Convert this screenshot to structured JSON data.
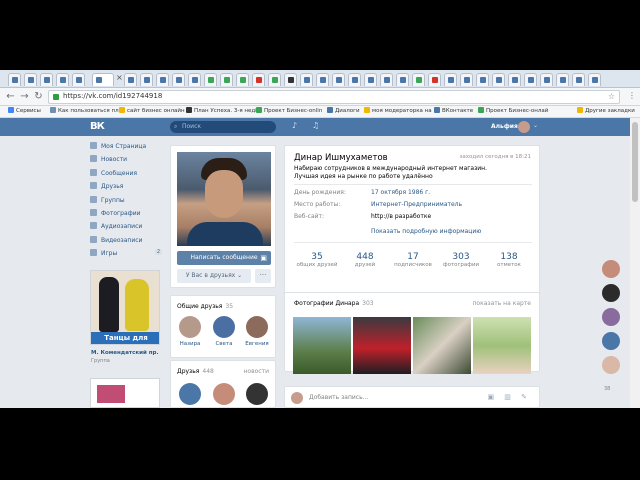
{
  "browser": {
    "tab_close": "×",
    "url": "https://vk.com/id192744918",
    "star": "☆",
    "menu": "⋮"
  },
  "bookmarks": [
    {
      "label": "Сервисы",
      "color": "#4285f4"
    },
    {
      "label": "Как пользоваться пл",
      "color": "#6f8fb5"
    },
    {
      "label": "сайт бизнес онлайн",
      "color": "#f2b705"
    },
    {
      "label": "План Успеха. 3-я неді",
      "color": "#333333"
    },
    {
      "label": "Проект Бизнес-onlin",
      "color": "#3aa757"
    },
    {
      "label": "Диалоги",
      "color": "#4a76a8"
    },
    {
      "label": "моя модераторка на",
      "color": "#f2b705"
    },
    {
      "label": "ВКонтакте",
      "color": "#4a76a8"
    },
    {
      "label": "Проект Бизнес-онлай",
      "color": "#3aa757"
    },
    {
      "label": "Другие закладки",
      "color": "#f2b705"
    }
  ],
  "vk": {
    "logo": "ВК",
    "search_placeholder": "Поиск",
    "user_name": "Альфия"
  },
  "nav": [
    {
      "label": "Моя Страница"
    },
    {
      "label": "Новости"
    },
    {
      "label": "Сообщения"
    },
    {
      "label": "Друзья"
    },
    {
      "label": "Группы"
    },
    {
      "label": "Фотографии"
    },
    {
      "label": "Аудиозаписи"
    },
    {
      "label": "Видеозаписи"
    },
    {
      "label": "Игры",
      "count": "2"
    }
  ],
  "ad": {
    "banner": "Танцы для детей",
    "title": "М. Комендатский пр.",
    "subtitle": "Группа"
  },
  "profile": {
    "name": "Динар Ишмухаметов",
    "online": "заходил сегодня в 18:21",
    "status": "Набираю сотрудников в международный интернет магазин. Лучшая идея на рынке по работе удалённо",
    "rows": [
      {
        "label": "День рождения:",
        "value": "17 октября 1986 г."
      },
      {
        "label": "Место работы:",
        "value": "Интернет-Предприниматель"
      },
      {
        "label": "Веб-сайт:",
        "value": "http://в разработке"
      }
    ],
    "show_more": "Показать подробную информацию",
    "counters": [
      {
        "num": "35",
        "label": "общих друзей"
      },
      {
        "num": "448",
        "label": "друзей"
      },
      {
        "num": "17",
        "label": "подписчиков"
      },
      {
        "num": "303",
        "label": "фотографии"
      },
      {
        "num": "138",
        "label": "отметок"
      }
    ],
    "send_message": "Написать сообщение",
    "in_friends": "У Вас в друзьях ⌄",
    "more": "···"
  },
  "common_friends": {
    "title": "Общие друзья",
    "count": "35",
    "items": [
      {
        "name": "Назира",
        "color": "#b59a8c"
      },
      {
        "name": "Света",
        "color": "#4c6fa3"
      },
      {
        "name": "Евгения",
        "color": "#8c6b5d"
      }
    ]
  },
  "friends": {
    "title": "Друзья",
    "count": "448",
    "news": "новости"
  },
  "photos": {
    "title": "Фотографии Динара",
    "count": "303",
    "map": "показать на карте"
  },
  "post": {
    "placeholder": "Добавить запись...",
    "icons": "▣ ▥ ✎"
  },
  "right_count": "38"
}
